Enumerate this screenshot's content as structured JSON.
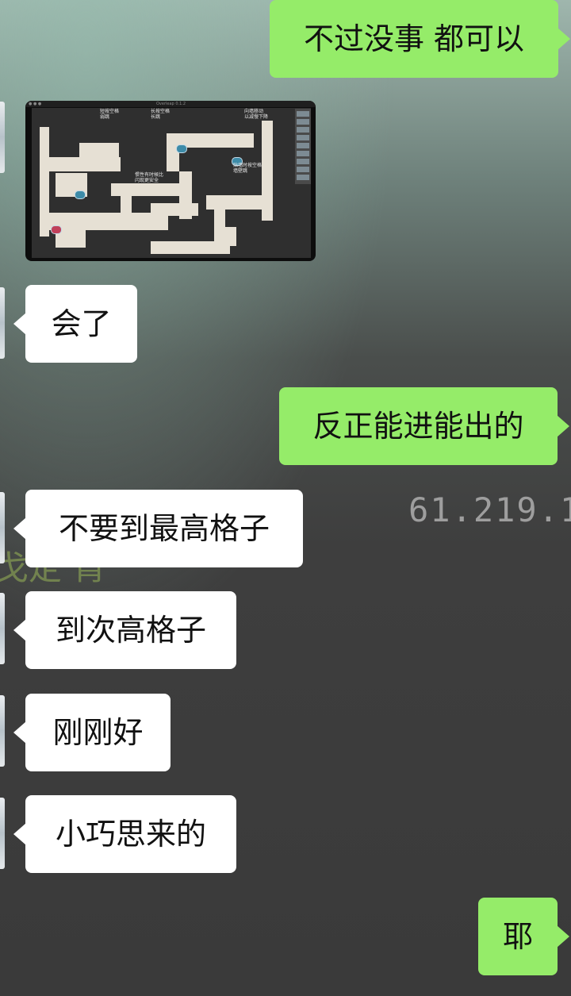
{
  "background": {
    "ip_fragment": "61.219.1",
    "green_fragment": "戈定 肓"
  },
  "messages": [
    {
      "id": "m1",
      "side": "out",
      "text": "不过没事 都可以"
    },
    {
      "id": "m2",
      "side": "in",
      "type": "image",
      "caption": "游戏地图截图"
    },
    {
      "id": "m3",
      "side": "in",
      "text": "会了"
    },
    {
      "id": "m4",
      "side": "out",
      "text": "反正能进能出的"
    },
    {
      "id": "m5",
      "side": "in",
      "text": "不要到最高格子"
    },
    {
      "id": "m6",
      "side": "in",
      "text": "到次高格子"
    },
    {
      "id": "m7",
      "side": "in",
      "text": "刚刚好"
    },
    {
      "id": "m8",
      "side": "in",
      "text": "小巧思来的"
    },
    {
      "id": "m9",
      "side": "out",
      "text": "耶"
    }
  ],
  "thumbnail": {
    "window_title": "Overleap 0.1.2",
    "notes": [
      "短按空格\n弱跳",
      "长按空格\n长跳",
      "向墙移动\n以减慢下降",
      "惯性有时候比\n闪现更安全",
      "贴墙时按空格\n墙壁跳"
    ]
  },
  "colors": {
    "outgoing_bubble": "#95ec69",
    "incoming_bubble": "#ffffff",
    "background_dark": "#3a3a3a"
  }
}
